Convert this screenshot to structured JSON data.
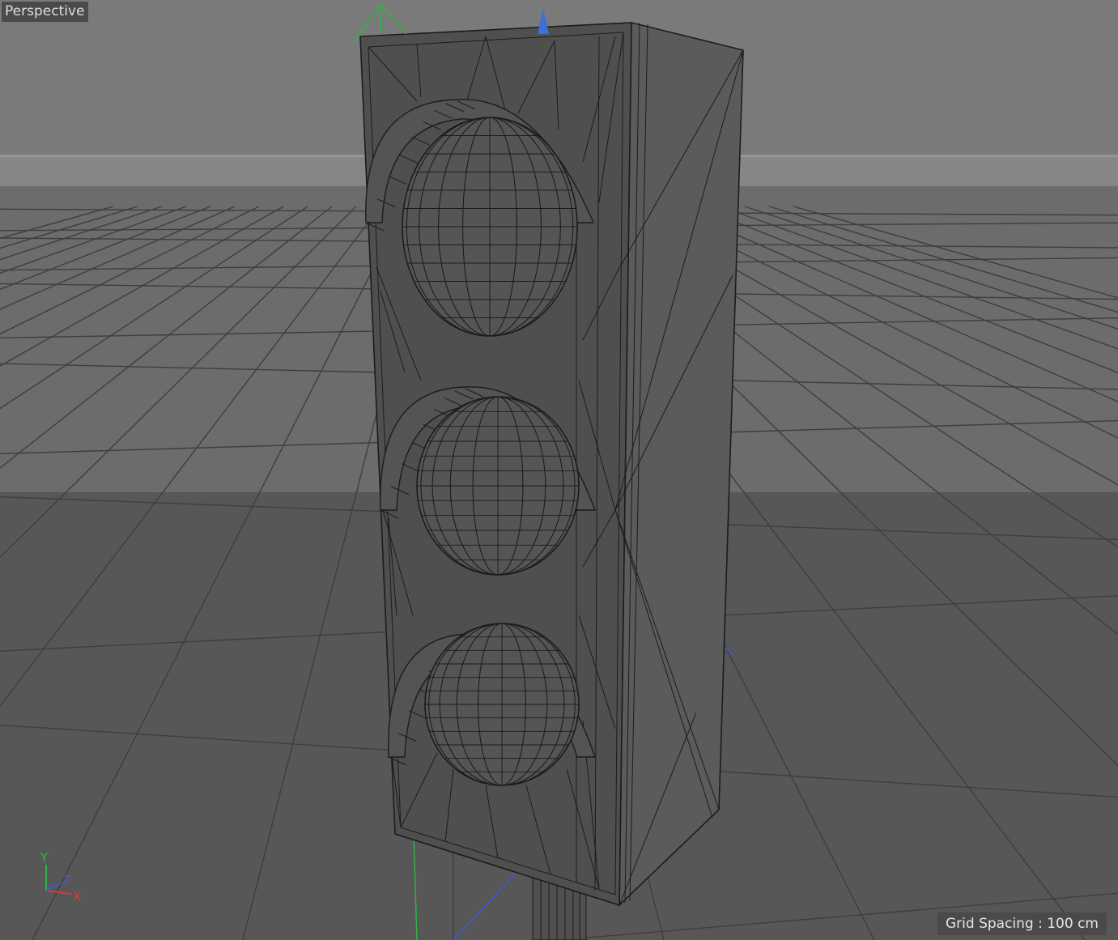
{
  "viewport": {
    "label": "Perspective",
    "grid_spacing_label": "Grid Spacing : 100 cm"
  },
  "axis_gizmo": {
    "y": "Y",
    "z": "Z",
    "x": "X"
  },
  "colors": {
    "sky": "#7a7a7a",
    "horizon_band": "#868686",
    "floor_far": "#6b6b6b",
    "floor_near": "#575757",
    "object_front": "#4f4f4f",
    "object_side": "#5b5b5b",
    "wire": "#1c1c1c",
    "axis_x": "#d23c3c",
    "axis_y": "#2fb34a",
    "axis_z": "#3c5ad8"
  },
  "icons": {
    "move_handle_y": "green-arrow-icon",
    "move_handle_z": "blue-cone-icon"
  }
}
